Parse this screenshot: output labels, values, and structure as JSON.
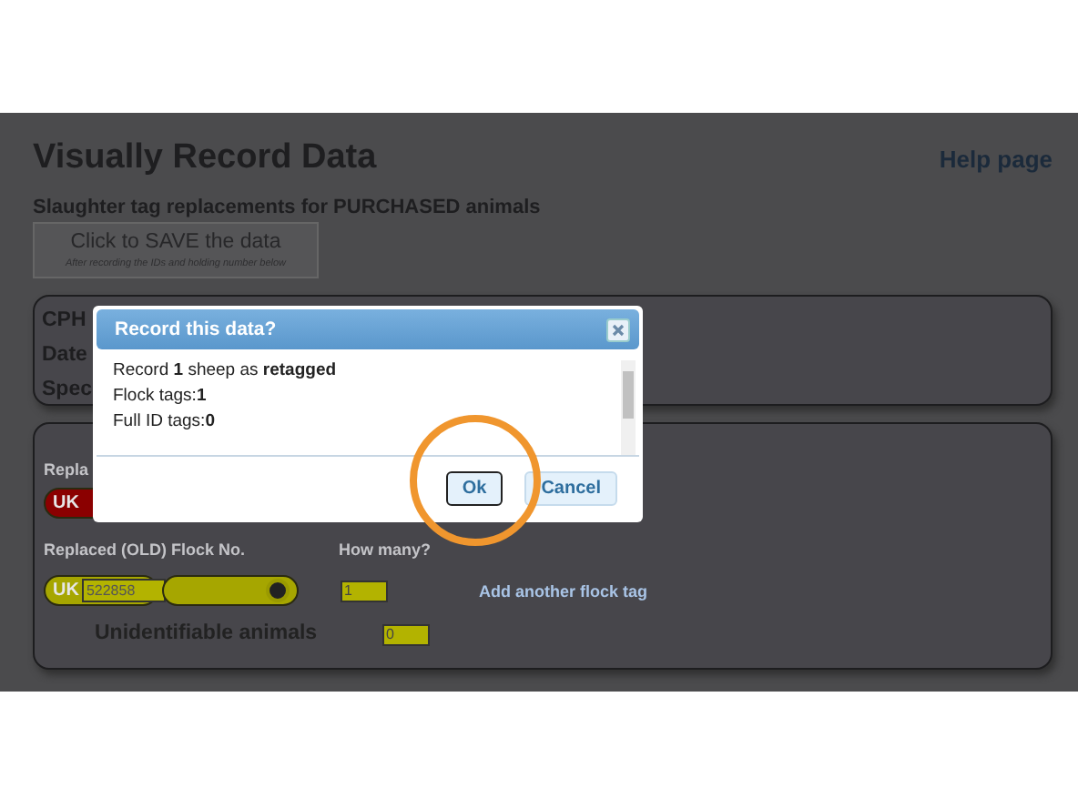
{
  "page": {
    "title": "Visually Record Data",
    "help_link": "Help page",
    "subtitle": "Slaughter tag replacements for **PURCHASED** animals",
    "save_button": {
      "label": "Click to SAVE the data",
      "hint": "After recording the IDs and holding number below"
    }
  },
  "details_card": {
    "labels": [
      "CPH",
      "Date",
      "Spec"
    ]
  },
  "tags_card": {
    "replacement_label": "Repla",
    "red_tag": {
      "prefix": "UK"
    },
    "old_flock_label": "Replaced (OLD) Flock No.",
    "how_many_label": "How many?",
    "old_tag": {
      "prefix": "UK",
      "value": "522858"
    },
    "how_many_value": "1",
    "add_link": "Add another flock tag",
    "unidentifiable_label": "Unidentifiable animals",
    "unidentifiable_value": "0"
  },
  "dialog": {
    "title": "Record this data?",
    "lines": [
      "Record **1** sheep as **retagged**",
      "Flock tags:**1**",
      "Full ID tags:**0**"
    ],
    "buttons": [
      {
        "label": "Ok",
        "selected": true,
        "highlighted": true
      },
      {
        "label": "Cancel",
        "selected": false,
        "highlighted": false
      }
    ]
  }
}
